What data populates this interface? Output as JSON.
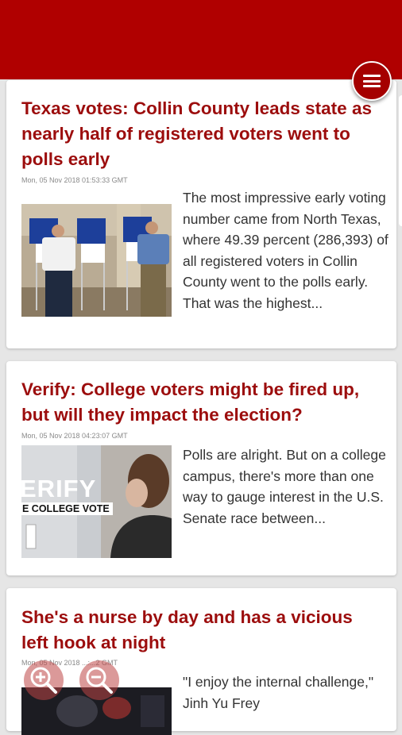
{
  "articles": [
    {
      "title": "Texas votes: Collin County leads state as nearly half of registered voters went to polls early",
      "date": "Mon, 05 Nov 2018 01:53:33 GMT",
      "excerpt": "The most impressive early voting number came from North Texas, where 49.39 percent (286,393) of all registered voters in Collin County went to the polls early. That was the highest..."
    },
    {
      "title": "Verify: College voters might be fired up, but will they impact the election?",
      "date": "Mon, 05 Nov 2018 04:23:07 GMT",
      "excerpt": "Polls are alright. But on a college campus, there's more than one way to gauge interest in the U.S. Senate race between...",
      "image_overlay_line1": "ERIFY",
      "image_overlay_line2": "E COLLEGE VOTE"
    },
    {
      "title": "She's a nurse by day and has a vicious left hook at night",
      "date": "Mon, 05 Nov 2018 ...:...2 GMT",
      "excerpt": "\"I enjoy the internal challenge,\" Jinh Yu Frey"
    }
  ],
  "icons": {
    "menu": "hamburger-menu-icon",
    "zoom_in": "zoom-in-icon",
    "zoom_out": "zoom-out-icon"
  },
  "colors": {
    "brand": "#b00000",
    "headline": "#9c0d0d"
  }
}
